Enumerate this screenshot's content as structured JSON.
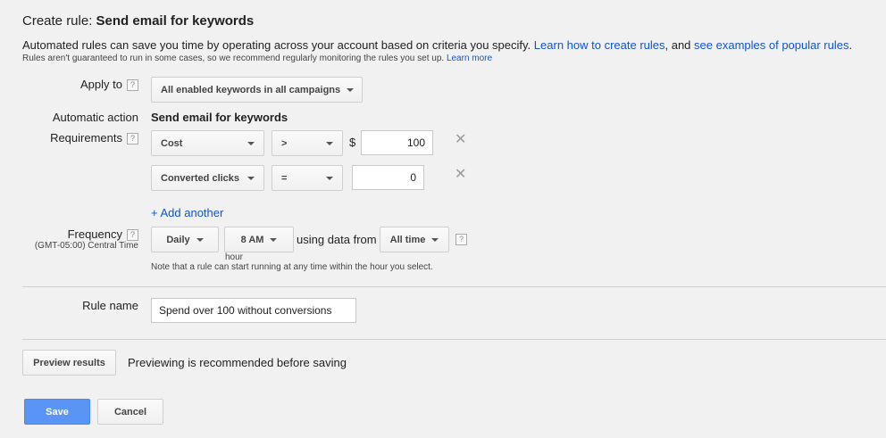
{
  "header": {
    "title_prefix": "Create rule:",
    "title_name": "Send email for keywords"
  },
  "intro": {
    "text": "Automated rules can save you time by operating across your account based on criteria you specify.",
    "link1": "Learn how to create rules",
    "mid": ", and",
    "link2": "see examples of popular rules",
    "end": ".",
    "small_text": "Rules aren't guaranteed to run in some cases, so we recommend regularly monitoring the rules you set up.",
    "small_link": "Learn more"
  },
  "apply_to": {
    "label": "Apply to",
    "help": "?",
    "value": "All enabled keywords in all campaigns"
  },
  "action": {
    "label": "Automatic action",
    "value": "Send email for keywords"
  },
  "requirements": {
    "label": "Requirements",
    "help": "?",
    "rows": [
      {
        "metric": "Cost",
        "operator": ">",
        "currency": "$",
        "value": "100",
        "remove": "✕"
      },
      {
        "metric": "Converted clicks",
        "operator": "=",
        "currency": "",
        "value": "0",
        "remove": "✕"
      }
    ],
    "add_another": "+ Add another"
  },
  "frequency": {
    "label": "Frequency",
    "help": "?",
    "timezone": "(GMT-05:00) Central Time",
    "period": "Daily",
    "hour": "8 AM",
    "hour_caption": "hour",
    "using_text": "using data from",
    "range": "All time",
    "range_help": "?",
    "note": "Note that a rule can start running at any time within the hour you select."
  },
  "rule_name": {
    "label": "Rule name",
    "value": "Spend over 100 without conversions"
  },
  "preview": {
    "button": "Preview results",
    "note": "Previewing is recommended before saving"
  },
  "footer": {
    "save": "Save",
    "cancel": "Cancel"
  },
  "colors": {
    "background": "#f1f1f1",
    "link": "#1155cc",
    "primary_button": "#5a95f5"
  }
}
